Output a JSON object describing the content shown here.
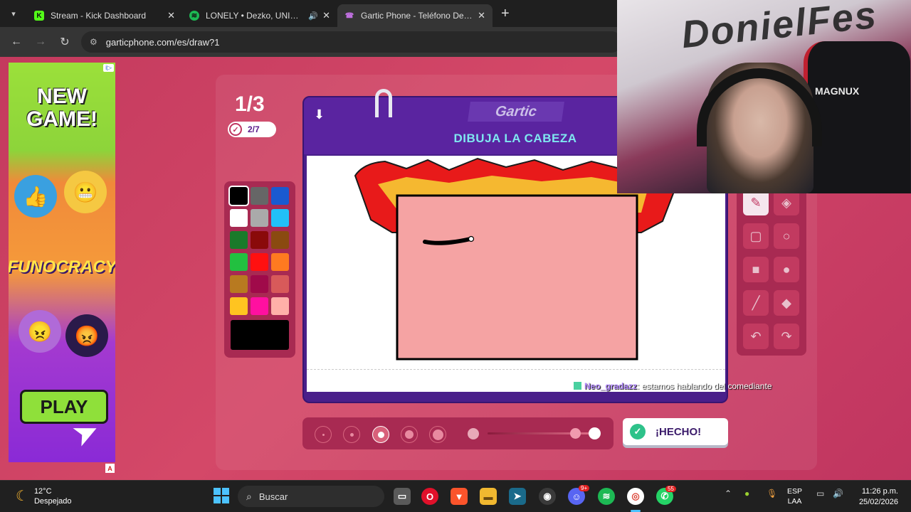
{
  "tabs": [
    {
      "title": "Stream - Kick Dashboard",
      "icon": "kick-icon",
      "color": "#53fc18",
      "glyph": "K"
    },
    {
      "title": "LONELY • Dezko, UNIVERSE",
      "icon": "spotify-icon",
      "color": "#1db954",
      "glyph": "≋",
      "audio": "🔊"
    },
    {
      "title": "Gartic Phone - Teléfono Descon",
      "icon": "gartic-phone-icon",
      "color": "#b063d8",
      "glyph": "☎"
    }
  ],
  "address": {
    "url": "garticphone.com/es/draw?1"
  },
  "ad": {
    "info": "i▷",
    "title": "NEW GAME!",
    "logo": "FUNOCRACY",
    "play": "PLAY",
    "badge": "A"
  },
  "game": {
    "round": "1/3",
    "turn": "2/7",
    "logo": "Gartic",
    "prompt": "DIBUJA LA CABEZA",
    "done": "¡HECHO!",
    "colors": [
      "#000000",
      "#666666",
      "#1a5ad0",
      "#ffffff",
      "#aaaaaa",
      "#22c0f8",
      "#1a7a2a",
      "#8a0a0a",
      "#8a4a10",
      "#22c040",
      "#ff1010",
      "#ff7a20",
      "#b87a20",
      "#a00a4a",
      "#d85a5a",
      "#ffc420",
      "#ff10a0",
      "#ffb0a8"
    ],
    "current_color": "#000000"
  },
  "chat": {
    "user": "Neo_gradazz",
    "message": ": estamos hablando del comediante"
  },
  "cam": {
    "graffiti": "DonielFes",
    "chair_brand": "MAGNUX"
  },
  "taskbar": {
    "weather_temp": "12°C",
    "weather_desc": "Despejado",
    "search": "Buscar",
    "lang1": "ESP",
    "lang2": "LAA",
    "time": "11:26 p.m.",
    "date": "25/02/2026",
    "whatsapp_badge": "55",
    "discord_badge": "9+"
  }
}
